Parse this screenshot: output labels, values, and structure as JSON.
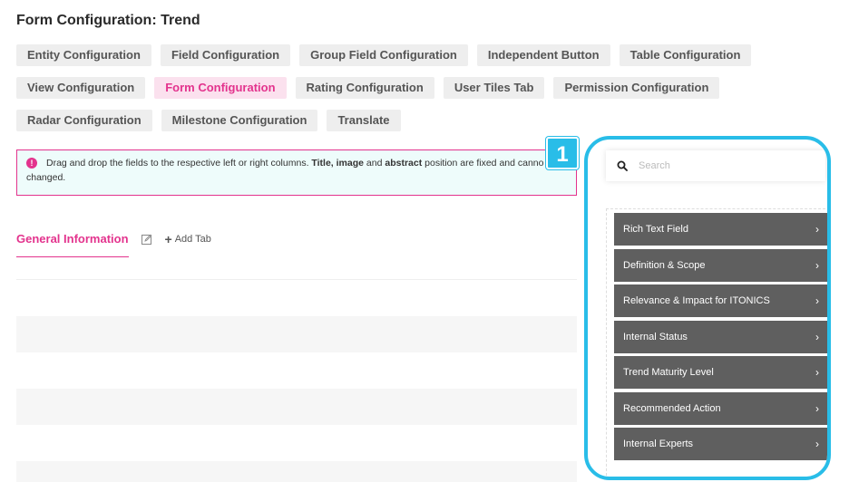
{
  "page": {
    "title": "Form Configuration: Trend"
  },
  "config_tabs": [
    {
      "label": "Entity Configuration",
      "active": false
    },
    {
      "label": "Field Configuration",
      "active": false
    },
    {
      "label": "Group Field Configuration",
      "active": false
    },
    {
      "label": "Independent Button",
      "active": false
    },
    {
      "label": "Table Configuration",
      "active": false
    },
    {
      "label": "View Configuration",
      "active": false
    },
    {
      "label": "Form Configuration",
      "active": true
    },
    {
      "label": "Rating Configuration",
      "active": false
    },
    {
      "label": "User Tiles Tab",
      "active": false
    },
    {
      "label": "Permission Configuration",
      "active": false
    },
    {
      "label": "Radar Configuration",
      "active": false
    },
    {
      "label": "Milestone Configuration",
      "active": false
    },
    {
      "label": "Translate",
      "active": false
    }
  ],
  "notice": {
    "icon": "info-icon",
    "text_before": "Drag and drop the fields to the respective left or right columns. ",
    "bold_1": "Title, image",
    "text_middle": " and ",
    "bold_2": "abstract",
    "text_after": " position are fixed and canno",
    "line2": "changed."
  },
  "badge": {
    "number": "1"
  },
  "section_tabs": {
    "general": "General Information",
    "add_tab": "Add Tab"
  },
  "search": {
    "placeholder": "Search",
    "value": ""
  },
  "fields": [
    {
      "label": "Rich Text Field"
    },
    {
      "label": "Definition & Scope"
    },
    {
      "label": "Relevance & Impact for ITONICS"
    },
    {
      "label": "Internal Status"
    },
    {
      "label": "Trend Maturity Level"
    },
    {
      "label": "Recommended Action"
    },
    {
      "label": "Internal Experts"
    }
  ],
  "colors": {
    "accent_pink": "#e3338d",
    "highlight_blue": "#29bde8",
    "field_item_bg": "#5f5f5f",
    "notice_bg": "#eefcfb"
  }
}
